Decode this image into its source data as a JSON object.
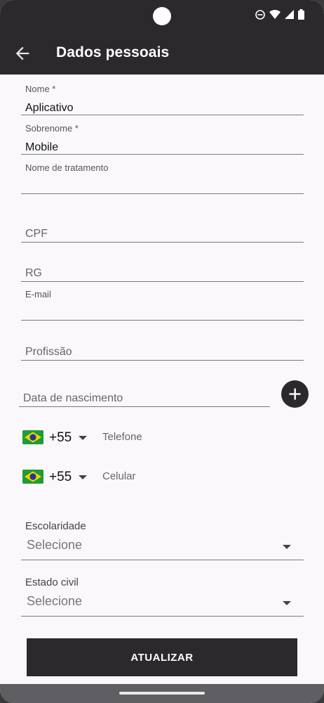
{
  "app": {
    "title": "Dados pessoais",
    "accent_color": "#2b292b",
    "background_color": "#faf8fb"
  },
  "status_bar": {
    "icons": [
      "dnd-icon",
      "wifi-icon",
      "signal-icon",
      "battery-icon"
    ]
  },
  "form": {
    "nome": {
      "label": "Nome *",
      "value": "Aplicativo"
    },
    "sobrenome": {
      "label": "Sobrenome *",
      "value": "Mobile"
    },
    "tratamento": {
      "label": "Nome de tratamento",
      "value": ""
    },
    "cpf": {
      "placeholder": "CPF"
    },
    "rg": {
      "placeholder": "RG"
    },
    "email": {
      "label": "E-mail",
      "value": ""
    },
    "profissao": {
      "placeholder": "Profissão"
    },
    "nascimento": {
      "placeholder": "Data de nascimento"
    },
    "telefone": {
      "country_code": "+55",
      "placeholder": "Telefone"
    },
    "celular": {
      "country_code": "+55",
      "placeholder": "Celular"
    },
    "escolaridade": {
      "label": "Escolaridade",
      "selected": "Selecione"
    },
    "estado_civil": {
      "label": "Estado civil",
      "selected": "Selecione"
    },
    "submit_label": "ATUALIZAR"
  }
}
